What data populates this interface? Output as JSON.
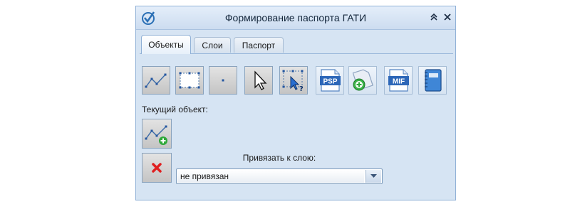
{
  "window": {
    "title": "Формирование паспорта ГАТИ",
    "controls": [
      "collapse",
      "close"
    ]
  },
  "tabs": [
    {
      "label": "Объекты",
      "active": true
    },
    {
      "label": "Слои",
      "active": false
    },
    {
      "label": "Паспорт",
      "active": false
    }
  ],
  "toolbar": {
    "tools": [
      {
        "icon": "polyline-icon",
        "pressed": true
      },
      {
        "icon": "rectangle-icon",
        "pressed": true
      },
      {
        "icon": "point-icon",
        "pressed": true
      },
      {
        "icon": "pointer-icon",
        "pressed": true
      },
      {
        "icon": "select-query-icon",
        "pressed": true
      },
      {
        "icon": "psp-file-icon",
        "pressed": false,
        "text": "PSP"
      },
      {
        "icon": "add-document-icon",
        "pressed": false
      },
      {
        "icon": "mif-file-icon",
        "pressed": false,
        "text": "MIF"
      },
      {
        "icon": "notebook-icon",
        "pressed": false
      }
    ]
  },
  "current_object": {
    "label": "Текущий объект:",
    "add_icon": "polyline-add-icon",
    "delete_icon": "delete-icon"
  },
  "layer_binding": {
    "label": "Привязать к слою:",
    "selected": "не привязан"
  },
  "colors": {
    "window_bg": "#d6e4f3",
    "accent": "#2a6fb5",
    "delete_red": "#e02020",
    "add_green": "#2fa83a"
  }
}
